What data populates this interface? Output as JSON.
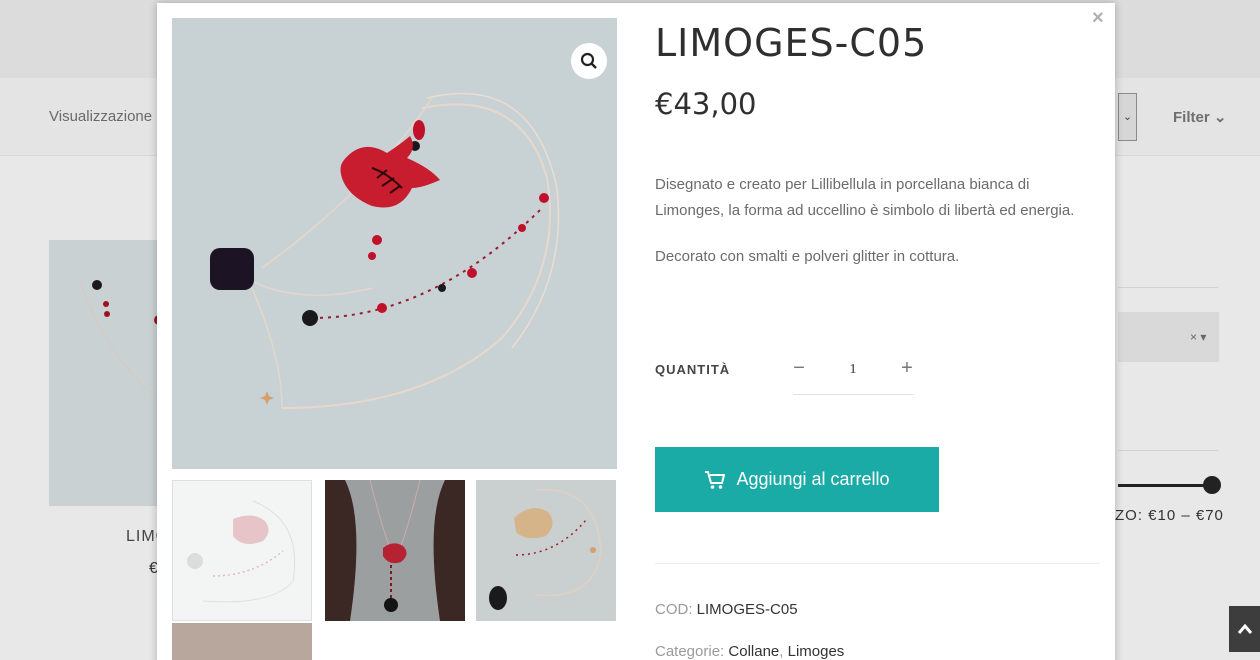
{
  "background": {
    "sort_label": "Visualizzazione",
    "filter_label": "Filter",
    "product_title": "LIMO",
    "product_price": "€",
    "price_range": "ZO: €10 – €70"
  },
  "modal": {
    "close": "×",
    "title": "LIMOGES-C05",
    "price": "€43,00",
    "description": [
      "Disegnato e creato per Lillibellula in porcellana bianca di Limonges, la forma ad uccellino è simbolo di libertà ed energia.",
      "Decorato con smalti e polveri glitter in cottura."
    ],
    "quantity": {
      "label": "QUANTITÀ",
      "value": "1",
      "minus": "−",
      "plus": "+"
    },
    "add_to_cart": "Aggiungi al carrello",
    "sku_label": "COD:",
    "sku_value": "LIMOGES-C05",
    "categories_label": "Categorie:",
    "categories": [
      "Collane",
      "Limoges"
    ]
  },
  "colors": {
    "accent": "#1aaba6",
    "title": "#2f2f2f"
  },
  "icons": {
    "zoom": "search-icon",
    "cart": "cart-icon",
    "close": "close-icon",
    "scroll_top": "chevron-up-icon"
  }
}
